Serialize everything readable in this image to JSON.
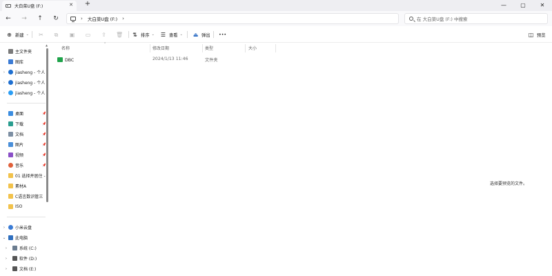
{
  "window": {
    "tab_title": "大白菜U盘 (F:)",
    "tab_close": "✕",
    "new_tab": "+",
    "minimize": "—",
    "maximize": "▢",
    "close": "✕"
  },
  "nav": {
    "back": "←",
    "forward": "→",
    "up": "↑",
    "refresh": "↻"
  },
  "address": {
    "chevron1": "›",
    "location": "大白菜U盘 (F:)",
    "chevron2": "›"
  },
  "search": {
    "placeholder": "在 大白菜U盘 (F:) 中搜索"
  },
  "command_bar": {
    "new_label": "新建",
    "sort_label": "排序",
    "view_label": "查看",
    "eject_label": "弹出",
    "more_label": "•••",
    "preview_label": "预览"
  },
  "sidebar": {
    "items": [
      {
        "label": "主文件夹",
        "icon": "home-icon"
      },
      {
        "label": "图库",
        "icon": "gallery-icon"
      },
      {
        "label": "jiasheng - 个人",
        "icon": "cloud-icon"
      },
      {
        "label": "jiasheng - 个人",
        "icon": "cloud-icon"
      },
      {
        "label": "jiasheng - 个人",
        "icon": "cloud-icon"
      },
      {
        "label": "桌面",
        "icon": "desktop-icon"
      },
      {
        "label": "下载",
        "icon": "download-icon"
      },
      {
        "label": "文档",
        "icon": "document-icon"
      },
      {
        "label": "图片",
        "icon": "picture-icon"
      },
      {
        "label": "视频",
        "icon": "video-icon"
      },
      {
        "label": "音乐",
        "icon": "music-icon"
      },
      {
        "label": "01 选择并居住 -(",
        "icon": "folder-icon"
      },
      {
        "label": "素材A",
        "icon": "folder-icon"
      },
      {
        "label": "C语言数识管三 ",
        "icon": "folder-icon"
      },
      {
        "label": "ISO",
        "icon": "folder-icon"
      },
      {
        "label": "小米云盘",
        "icon": "cloud-icon"
      },
      {
        "label": "此电脑",
        "icon": "pc-icon"
      },
      {
        "label": "系统 (C:)",
        "icon": "drive-icon"
      },
      {
        "label": "软件 (D:)",
        "icon": "drive-icon"
      },
      {
        "label": "文档 (E:)",
        "icon": "drive-icon"
      }
    ]
  },
  "columns": {
    "name": "名称",
    "modified": "修改日期",
    "type": "类型",
    "size": "大小"
  },
  "files": [
    {
      "name": "DBC",
      "modified": "2024/1/13 11:46",
      "type": "文件夹",
      "size": ""
    }
  ],
  "preview_message": "选择要预览的文件。"
}
